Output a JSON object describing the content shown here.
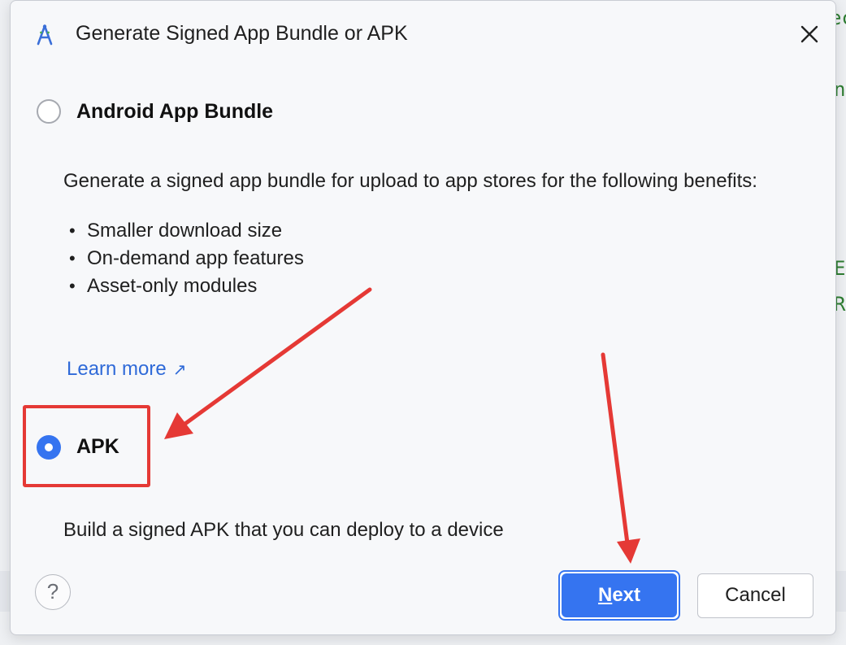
{
  "background": {
    "fragments": [
      "ec",
      "n",
      "EI",
      "Ri"
    ]
  },
  "dialog": {
    "title": "Generate Signed App Bundle or APK",
    "app_icon": "android-studio-icon",
    "close_icon": "close-icon",
    "options": [
      {
        "label": "Android App Bundle",
        "selected": false,
        "description": "Generate a signed app bundle for upload to app stores for the following benefits:",
        "benefits": [
          "Smaller download size",
          "On-demand app features",
          "Asset-only modules"
        ],
        "learn_more": "Learn more",
        "learn_more_icon": "external-link-icon"
      },
      {
        "label": "APK",
        "selected": true,
        "description": "Build a signed APK that you can deploy to a device"
      }
    ],
    "buttons": {
      "help": "?",
      "next_mnemonic": "N",
      "next_rest": "ext",
      "cancel": "Cancel"
    }
  },
  "annotations": {
    "color": "#e53935",
    "highlight": "apk-option",
    "arrows": [
      "to-apk-option",
      "to-next-button"
    ]
  },
  "colors": {
    "accent": "#3574f0",
    "link": "#2f6ad8",
    "annotation": "#e53935"
  }
}
